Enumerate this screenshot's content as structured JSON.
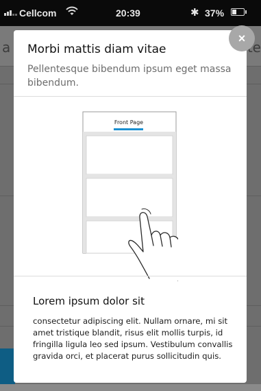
{
  "status_bar": {
    "carrier": "Cellcom",
    "time": "20:39",
    "battery_percent": "37%",
    "battery_level": 0.37
  },
  "background": {
    "left_peek_text": "a",
    "right_peek_text": "te"
  },
  "modal": {
    "title": "Morbi mattis diam vitae",
    "subtitle": "Pellentesque bibendum ipsum eget massa bibendum.",
    "illustration": {
      "tab_label": "Front Page",
      "accent_color": "#1a8fd0",
      "icon": "hand-swipe-icon"
    },
    "card_title": "Lorem ipsum dolor sit",
    "card_body": "consectetur adipiscing elit. Nullam ornare, mi sit amet tristique blandit, risus elit mollis turpis, id fringilla ligula leo sed ipsum. Vestibulum convallis gravida orci, et placerat purus sollicitudin quis.",
    "close_label": "×"
  }
}
